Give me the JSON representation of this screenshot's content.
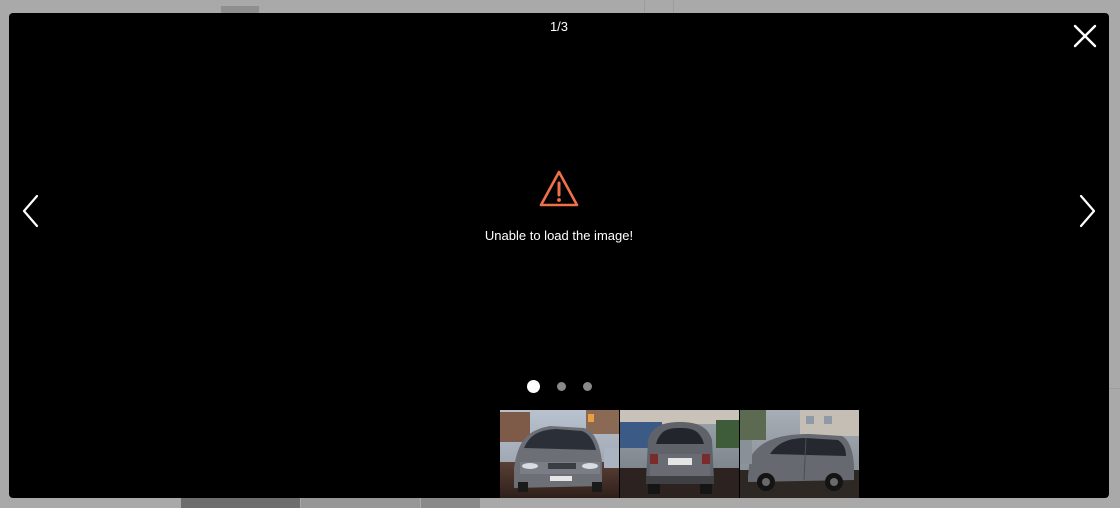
{
  "lightbox": {
    "counter": "1/3",
    "error_message": "Unable to load the image!",
    "accent_color": "#f0704a",
    "current_index": 1,
    "total": 3
  },
  "controls": {
    "close_icon": "close-icon",
    "prev_icon": "chevron-left-icon",
    "next_icon": "chevron-right-icon",
    "warning_icon": "warning-triangle-icon"
  },
  "dots": [
    {
      "active": true
    },
    {
      "active": false
    },
    {
      "active": false
    }
  ],
  "thumbnails": [
    {
      "subject": "grey minivan front view"
    },
    {
      "subject": "grey minivan rear view"
    },
    {
      "subject": "grey minivan side view"
    }
  ]
}
